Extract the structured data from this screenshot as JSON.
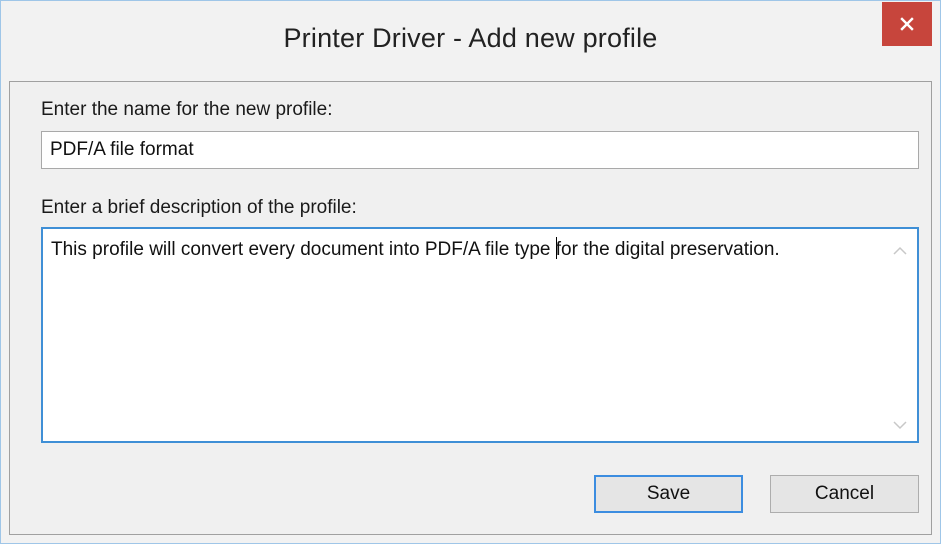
{
  "window": {
    "title": "Printer Driver - Add new profile",
    "close_icon": "close-icon",
    "accent_close": "#c7453c",
    "accent_focus": "#3f8fd6"
  },
  "form": {
    "name_label": "Enter the name for the new profile:",
    "name_value": "PDF/A file format",
    "description_label": "Enter a brief description of the profile:",
    "description_before_caret": "This profile will convert every document into PDF/A file type ",
    "description_after_caret": "for the digital preservation."
  },
  "buttons": {
    "save_label": "Save",
    "cancel_label": "Cancel"
  }
}
